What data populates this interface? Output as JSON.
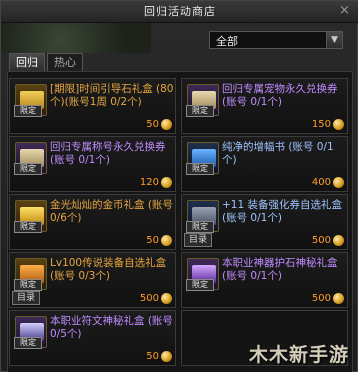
{
  "window": {
    "title": "回归活动商店"
  },
  "filter": {
    "value": "全部"
  },
  "tabs": [
    {
      "label": "回归"
    },
    {
      "label": "热心"
    }
  ],
  "badges": {
    "limit": "限定",
    "catalog": "目录"
  },
  "items": [
    {
      "name": "[期限]时间引导石礼盒 (80个)(账号1周 0/2个)",
      "price": "50",
      "color": "gold",
      "icon": "gift-box-icon",
      "limit": true,
      "catalog": false
    },
    {
      "name": "回归专属宠物永久兑换券(账号 0/1个)",
      "price": "150",
      "color": "purple",
      "icon": "scroll-icon",
      "limit": true,
      "catalog": false
    },
    {
      "name": "回归专属称号永久兑换券(账号 0/1个)",
      "price": "120",
      "color": "purple",
      "icon": "scroll-icon",
      "limit": true,
      "catalog": false
    },
    {
      "name": "纯净的增幅书 (账号 0/1个)",
      "price": "400",
      "color": "blue",
      "icon": "book-icon",
      "limit": true,
      "catalog": false
    },
    {
      "name": "金光灿灿的金币礼盒 (账号 0/6个)",
      "price": "50",
      "color": "gold",
      "icon": "gold-box-icon",
      "limit": true,
      "catalog": false
    },
    {
      "name": "+11 装备强化券自选礼盒(账号 0/1个)",
      "price": "500",
      "color": "blue",
      "icon": "chest-icon",
      "limit": true,
      "catalog": true
    },
    {
      "name": "Lv100传说装备自选礼盒(账号 0/3个)",
      "price": "500",
      "color": "gold",
      "icon": "legend-box-icon",
      "limit": true,
      "catalog": true
    },
    {
      "name": "本职业神器护石神秘礼盒(账号 0/1个)",
      "price": "500",
      "color": "purple",
      "icon": "orb-box-icon",
      "limit": true,
      "catalog": false
    },
    {
      "name": "本职业符文神秘礼盒 (账号 0/5个)",
      "price": "50",
      "color": "purple",
      "icon": "rune-box-icon",
      "limit": true,
      "catalog": false
    }
  ],
  "watermark": "木木新手游"
}
